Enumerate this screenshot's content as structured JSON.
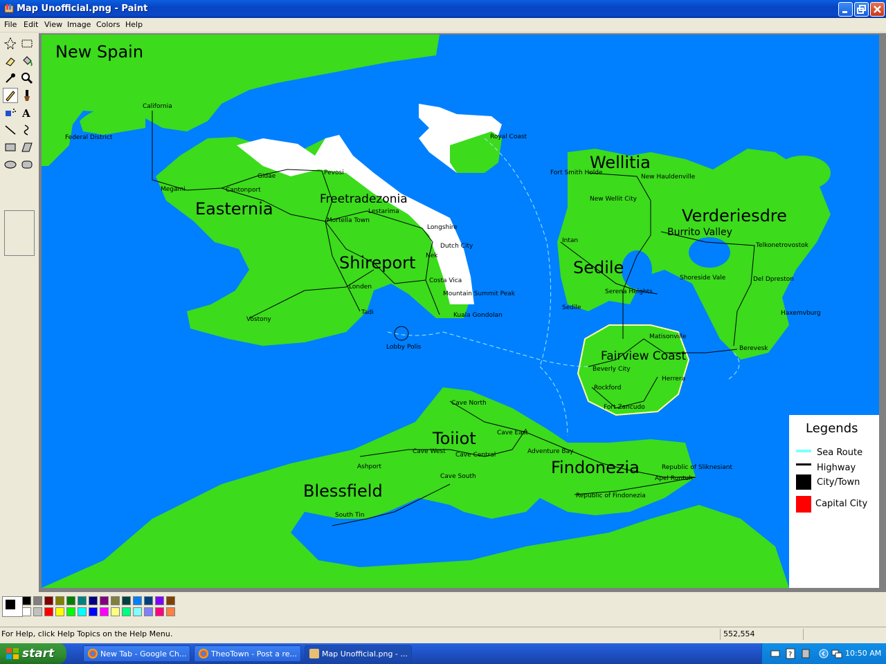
{
  "window": {
    "title": "Map Unofficial.png - Paint"
  },
  "menu": [
    "File",
    "Edit",
    "View",
    "Image",
    "Colors",
    "Help"
  ],
  "map": {
    "regions": [
      {
        "name": "New Spain",
        "type": "region"
      },
      {
        "name": "Easternia",
        "type": "region"
      },
      {
        "name": "Freetradezonia",
        "type": "region"
      },
      {
        "name": "Shireport",
        "type": "region"
      },
      {
        "name": "Wellitia",
        "type": "region"
      },
      {
        "name": "Verderiesdre",
        "type": "region"
      },
      {
        "name": "Sedile",
        "type": "region"
      },
      {
        "name": "Fairview Coast",
        "type": "region"
      },
      {
        "name": "Toiiot",
        "type": "region"
      },
      {
        "name": "Findonezia",
        "type": "region"
      },
      {
        "name": "Blessfield",
        "type": "region"
      }
    ],
    "cities": [
      "California",
      "Federal District",
      "Gidae",
      "Pevosi",
      "Megami",
      "Cantonport",
      "Lestarima",
      "Mortella Town",
      "Longshire",
      "Dutch City",
      "Nek",
      "Costa Vica",
      "Mountain Summit Peak",
      "Kuala Gondolan",
      "Londen",
      "Tadi",
      "Vostony",
      "Lobby Polis",
      "Royal Coast",
      "Fort Smith Holde",
      "New Hauldenville",
      "New Wellit City",
      "Burrito Valley",
      "Intan",
      "Telkonetrovostok",
      "Shoreside Vale",
      "Del Dpreston",
      "Serena Heights",
      "Sedile",
      "Haxemvburg",
      "Matisonville",
      "Berevesk",
      "Beverly City",
      "Herrera",
      "Rockford",
      "Fort Zancudo",
      "Cave North",
      "Cave East",
      "Cave West",
      "Cave Central",
      "Cave South",
      "Ashport",
      "Adventure Bay",
      "Republic of Sliknesiant",
      "Apel Runtuh",
      "Republic of Findonezia",
      "South Tin"
    ],
    "legend": {
      "title": "Legends",
      "items": [
        {
          "label": "Sea Route",
          "color": "#80ffff"
        },
        {
          "label": "Highway",
          "color": "#000000"
        },
        {
          "label": "City/Town",
          "color": "#000000"
        },
        {
          "label": "Capital City",
          "color": "#ff0000"
        }
      ]
    },
    "colors": {
      "sea": "#0080ff",
      "land": "#3cdb1c",
      "snow": "#ffffff",
      "beach": "#ffffa0"
    }
  },
  "palette": [
    "#000000",
    "#808080",
    "#800000",
    "#808000",
    "#008000",
    "#008080",
    "#000080",
    "#800080",
    "#808040",
    "#004040",
    "#0080ff",
    "#004080",
    "#8000ff",
    "#804000",
    "#ffffff",
    "#c0c0c0",
    "#ff0000",
    "#ffff00",
    "#00ff00",
    "#00ffff",
    "#0000ff",
    "#ff00ff",
    "#ffff80",
    "#00ff80",
    "#80ffff",
    "#8080ff",
    "#ff0080",
    "#ff8040"
  ],
  "status": {
    "help": "For Help, click Help Topics on the Help Menu.",
    "coords": "552,554"
  },
  "taskbar": {
    "start": "start",
    "tasks": [
      "New Tab - Google Ch...",
      "TheoTown - Post a re...",
      "Map Unofficial.png - ..."
    ],
    "clock": "10:50 AM"
  }
}
